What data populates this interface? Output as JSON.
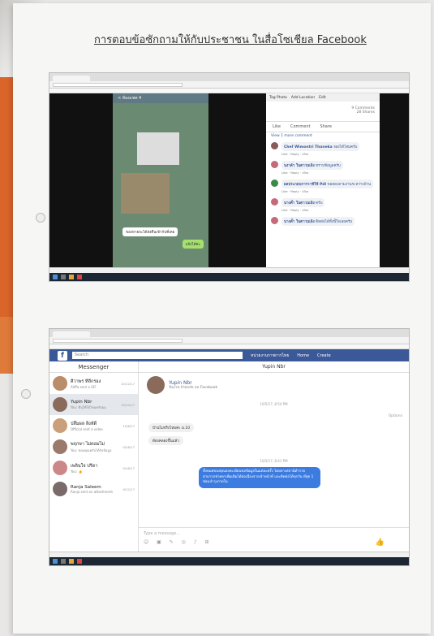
{
  "document": {
    "title": "การตอบข้อซักถามให้กับประชาชน ในสื่อโซเชียล Facebook"
  },
  "top_screenshot": {
    "fb_panel": {
      "toolbar": [
        "Tag Photo",
        "Add Location",
        "Edit"
      ],
      "comments_count": "9 Comments",
      "shares_count": "28 Shares",
      "actions": [
        "Like",
        "Comment",
        "Share"
      ],
      "view_more": "View 1 more comment",
      "comments": [
        {
          "name": "Chef Wimontri Thaneka",
          "text": "จองได้ไหมครับ"
        },
        {
          "name": "นงาค์า ในตาวนเลิง",
          "text": "ทราบข้อมูลครับ"
        },
        {
          "name": "ผลประกอบการวาชีใช้ Pdl",
          "text": "ขอสอบถามงานระหว่างบ้าน"
        },
        {
          "name": "นางค้ำ ในตาวนเลิง",
          "text": "ครับ"
        },
        {
          "name": "นางค้ำ ในตาวนเลิง",
          "text": "ติดต่อได้ทั้งนี้ใจเลยครับ"
        }
      ],
      "comment_actions": "Like · Reply · 45w"
    },
    "phone": {
      "header": "< ห้องแชท 4",
      "bubble_left": "ของหายจะได้ส่งคืนเข้ากับที่เคย",
      "bubble_right": "แจ้งได้ค่ะ"
    }
  },
  "bottom_screenshot": {
    "search_placeholder": "Search",
    "nav": [
      "หน่วยงานราชการไทย",
      "Home",
      "Create"
    ],
    "messenger_title": "Messenger",
    "conversations": [
      {
        "name": "ศิวาพร ที่ลีกรอง",
        "preview": "Aliffa sent a GIF",
        "date": "10/12/17"
      },
      {
        "name": "Yupin Nbr",
        "preview": "You: คืนให้ได้ไหมครับผม",
        "date": "10/10/17"
      },
      {
        "name": "ปลื้มผล สิงห์ดี",
        "preview": "Official sent a video",
        "date": "10/6/17"
      },
      {
        "name": "พฤกษา ไม่ดอมไม่",
        "preview": "You: ขอบคุณครับได้รับข้อมูล",
        "date": "9/28/17"
      },
      {
        "name": "เพลินใจ ปรีดา",
        "preview": "You: 👍",
        "date": "9/18/17"
      },
      {
        "name": "Ranja Saleem",
        "preview": "Ranja sent an attachment",
        "date": "9/12/17"
      }
    ],
    "chat": {
      "header": "Yupin Nbr",
      "contact_name": "Yupin Nbr",
      "contact_sub": "You're friends on Facebook",
      "sep1": "10/5/17, 8:54 PM",
      "msg1": "บ้านไม่จริงไหมค่ะ ม.10",
      "msg2": "ต้องคลองขึ้นแล้ว",
      "sep2": "10/5/17, 8:41 PM",
      "msg_out": "ทั้งหมดของคุณลงทะเบียนขอข้อมูลในแต่ละครั้ง โดยทางสถานีตำรวจสามารถช่วยหาเพิ่มเติมได้ต่อเนื่องจากเจ้าหน้าที่ และติดต่อได้ทุกวัน ที่สุด 1 ซ่อมบำรุงภายใน",
      "compose_placeholder": "Type a message...",
      "options_label": "Options"
    }
  }
}
